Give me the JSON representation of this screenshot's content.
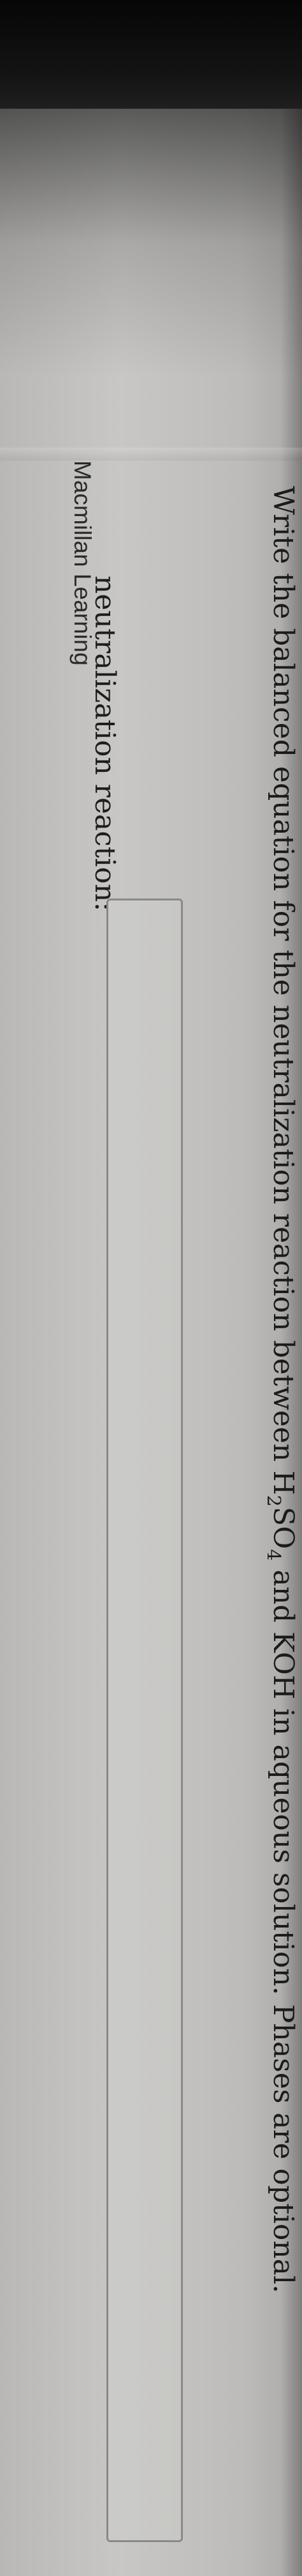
{
  "brand": {
    "name": "Macmillan Learning"
  },
  "question": {
    "prefix": "Write the balanced equation for the neutralization reaction between H",
    "sub1": "2",
    "mid": "SO",
    "sub2": "4",
    "suffix": " and KOH in aqueous solution. Phases are optional."
  },
  "answer": {
    "label": "neutralization reaction:",
    "value": ""
  }
}
